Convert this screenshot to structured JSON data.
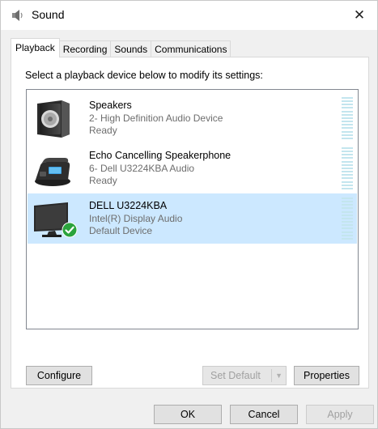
{
  "window": {
    "title": "Sound",
    "close_glyph": "✕",
    "icon": "speaker-icon"
  },
  "tabs": [
    {
      "label": "Playback",
      "active": true
    },
    {
      "label": "Recording",
      "active": false
    },
    {
      "label": "Sounds",
      "active": false
    },
    {
      "label": "Communications",
      "active": false
    }
  ],
  "instruction": "Select a playback device below to modify its settings:",
  "devices": [
    {
      "name": "Speakers",
      "description": "2- High Definition Audio Device",
      "status": "Ready",
      "icon": "speakers-icon",
      "selected": false
    },
    {
      "name": "Echo Cancelling Speakerphone",
      "description": "6- Dell U3224KBA Audio",
      "status": "Ready",
      "icon": "speakerphone-icon",
      "selected": false
    },
    {
      "name": "DELL U3224KBA",
      "description": "Intel(R) Display Audio",
      "status": "Default Device",
      "icon": "monitor-icon",
      "default_badge": "green-check-icon",
      "selected": true
    }
  ],
  "buttons": {
    "configure": "Configure",
    "set_default": "Set Default",
    "properties": "Properties",
    "ok": "OK",
    "cancel": "Cancel",
    "apply": "Apply"
  },
  "colors": {
    "selection": "#cce8ff",
    "meter": "#c3e5ee",
    "badge": "#2aa33c"
  }
}
